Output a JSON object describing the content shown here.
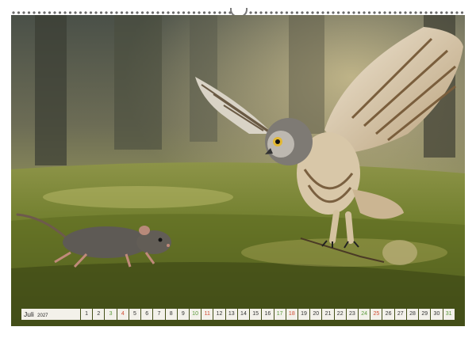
{
  "calendar": {
    "month": "Juli",
    "year": "2027",
    "days": [
      {
        "n": "1",
        "type": "weekday"
      },
      {
        "n": "2",
        "type": "weekday"
      },
      {
        "n": "3",
        "type": "sat"
      },
      {
        "n": "4",
        "type": "sun"
      },
      {
        "n": "5",
        "type": "weekday"
      },
      {
        "n": "6",
        "type": "weekday"
      },
      {
        "n": "7",
        "type": "weekday"
      },
      {
        "n": "8",
        "type": "weekday"
      },
      {
        "n": "9",
        "type": "weekday"
      },
      {
        "n": "10",
        "type": "sat"
      },
      {
        "n": "11",
        "type": "sun"
      },
      {
        "n": "12",
        "type": "weekday"
      },
      {
        "n": "13",
        "type": "weekday"
      },
      {
        "n": "14",
        "type": "weekday"
      },
      {
        "n": "15",
        "type": "weekday"
      },
      {
        "n": "16",
        "type": "weekday"
      },
      {
        "n": "17",
        "type": "sat"
      },
      {
        "n": "18",
        "type": "sun"
      },
      {
        "n": "19",
        "type": "weekday"
      },
      {
        "n": "20",
        "type": "weekday"
      },
      {
        "n": "21",
        "type": "weekday"
      },
      {
        "n": "22",
        "type": "weekday"
      },
      {
        "n": "23",
        "type": "weekday"
      },
      {
        "n": "24",
        "type": "sat"
      },
      {
        "n": "25",
        "type": "sun"
      },
      {
        "n": "26",
        "type": "weekday"
      },
      {
        "n": "27",
        "type": "weekday"
      },
      {
        "n": "28",
        "type": "weekday"
      },
      {
        "n": "29",
        "type": "weekday"
      },
      {
        "n": "30",
        "type": "weekday"
      },
      {
        "n": "31",
        "type": "sat"
      }
    ]
  },
  "colors": {
    "saturday": "#5a9a3a",
    "sunday": "#d04a30",
    "cell_background": "#f3f1ea"
  }
}
